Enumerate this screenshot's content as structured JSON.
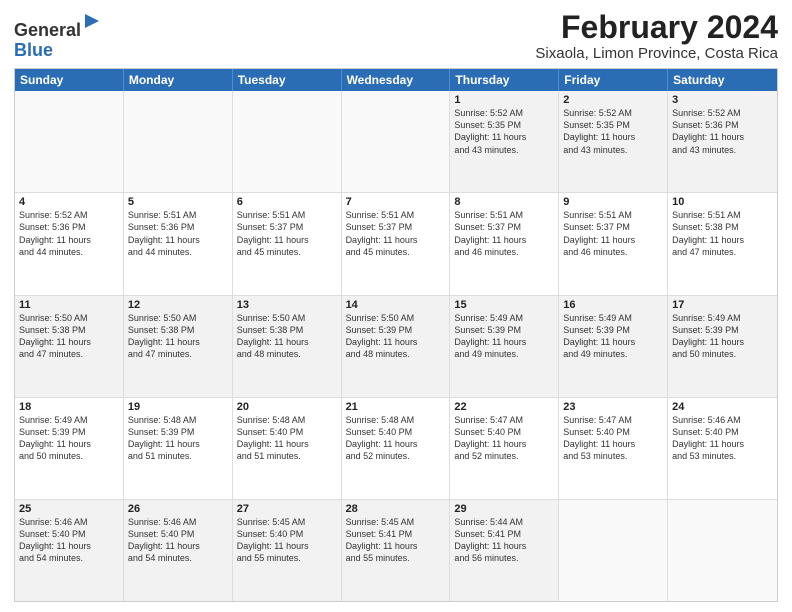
{
  "logo": {
    "general": "General",
    "blue": "Blue"
  },
  "header": {
    "month": "February 2024",
    "location": "Sixaola, Limon Province, Costa Rica"
  },
  "days_of_week": [
    "Sunday",
    "Monday",
    "Tuesday",
    "Wednesday",
    "Thursday",
    "Friday",
    "Saturday"
  ],
  "weeks": [
    [
      {
        "day": "",
        "info": ""
      },
      {
        "day": "",
        "info": ""
      },
      {
        "day": "",
        "info": ""
      },
      {
        "day": "",
        "info": ""
      },
      {
        "day": "1",
        "info": "Sunrise: 5:52 AM\nSunset: 5:35 PM\nDaylight: 11 hours\nand 43 minutes."
      },
      {
        "day": "2",
        "info": "Sunrise: 5:52 AM\nSunset: 5:35 PM\nDaylight: 11 hours\nand 43 minutes."
      },
      {
        "day": "3",
        "info": "Sunrise: 5:52 AM\nSunset: 5:36 PM\nDaylight: 11 hours\nand 43 minutes."
      }
    ],
    [
      {
        "day": "4",
        "info": "Sunrise: 5:52 AM\nSunset: 5:36 PM\nDaylight: 11 hours\nand 44 minutes."
      },
      {
        "day": "5",
        "info": "Sunrise: 5:51 AM\nSunset: 5:36 PM\nDaylight: 11 hours\nand 44 minutes."
      },
      {
        "day": "6",
        "info": "Sunrise: 5:51 AM\nSunset: 5:37 PM\nDaylight: 11 hours\nand 45 minutes."
      },
      {
        "day": "7",
        "info": "Sunrise: 5:51 AM\nSunset: 5:37 PM\nDaylight: 11 hours\nand 45 minutes."
      },
      {
        "day": "8",
        "info": "Sunrise: 5:51 AM\nSunset: 5:37 PM\nDaylight: 11 hours\nand 46 minutes."
      },
      {
        "day": "9",
        "info": "Sunrise: 5:51 AM\nSunset: 5:37 PM\nDaylight: 11 hours\nand 46 minutes."
      },
      {
        "day": "10",
        "info": "Sunrise: 5:51 AM\nSunset: 5:38 PM\nDaylight: 11 hours\nand 47 minutes."
      }
    ],
    [
      {
        "day": "11",
        "info": "Sunrise: 5:50 AM\nSunset: 5:38 PM\nDaylight: 11 hours\nand 47 minutes."
      },
      {
        "day": "12",
        "info": "Sunrise: 5:50 AM\nSunset: 5:38 PM\nDaylight: 11 hours\nand 47 minutes."
      },
      {
        "day": "13",
        "info": "Sunrise: 5:50 AM\nSunset: 5:38 PM\nDaylight: 11 hours\nand 48 minutes."
      },
      {
        "day": "14",
        "info": "Sunrise: 5:50 AM\nSunset: 5:39 PM\nDaylight: 11 hours\nand 48 minutes."
      },
      {
        "day": "15",
        "info": "Sunrise: 5:49 AM\nSunset: 5:39 PM\nDaylight: 11 hours\nand 49 minutes."
      },
      {
        "day": "16",
        "info": "Sunrise: 5:49 AM\nSunset: 5:39 PM\nDaylight: 11 hours\nand 49 minutes."
      },
      {
        "day": "17",
        "info": "Sunrise: 5:49 AM\nSunset: 5:39 PM\nDaylight: 11 hours\nand 50 minutes."
      }
    ],
    [
      {
        "day": "18",
        "info": "Sunrise: 5:49 AM\nSunset: 5:39 PM\nDaylight: 11 hours\nand 50 minutes."
      },
      {
        "day": "19",
        "info": "Sunrise: 5:48 AM\nSunset: 5:39 PM\nDaylight: 11 hours\nand 51 minutes."
      },
      {
        "day": "20",
        "info": "Sunrise: 5:48 AM\nSunset: 5:40 PM\nDaylight: 11 hours\nand 51 minutes."
      },
      {
        "day": "21",
        "info": "Sunrise: 5:48 AM\nSunset: 5:40 PM\nDaylight: 11 hours\nand 52 minutes."
      },
      {
        "day": "22",
        "info": "Sunrise: 5:47 AM\nSunset: 5:40 PM\nDaylight: 11 hours\nand 52 minutes."
      },
      {
        "day": "23",
        "info": "Sunrise: 5:47 AM\nSunset: 5:40 PM\nDaylight: 11 hours\nand 53 minutes."
      },
      {
        "day": "24",
        "info": "Sunrise: 5:46 AM\nSunset: 5:40 PM\nDaylight: 11 hours\nand 53 minutes."
      }
    ],
    [
      {
        "day": "25",
        "info": "Sunrise: 5:46 AM\nSunset: 5:40 PM\nDaylight: 11 hours\nand 54 minutes."
      },
      {
        "day": "26",
        "info": "Sunrise: 5:46 AM\nSunset: 5:40 PM\nDaylight: 11 hours\nand 54 minutes."
      },
      {
        "day": "27",
        "info": "Sunrise: 5:45 AM\nSunset: 5:40 PM\nDaylight: 11 hours\nand 55 minutes."
      },
      {
        "day": "28",
        "info": "Sunrise: 5:45 AM\nSunset: 5:41 PM\nDaylight: 11 hours\nand 55 minutes."
      },
      {
        "day": "29",
        "info": "Sunrise: 5:44 AM\nSunset: 5:41 PM\nDaylight: 11 hours\nand 56 minutes."
      },
      {
        "day": "",
        "info": ""
      },
      {
        "day": "",
        "info": ""
      }
    ]
  ]
}
